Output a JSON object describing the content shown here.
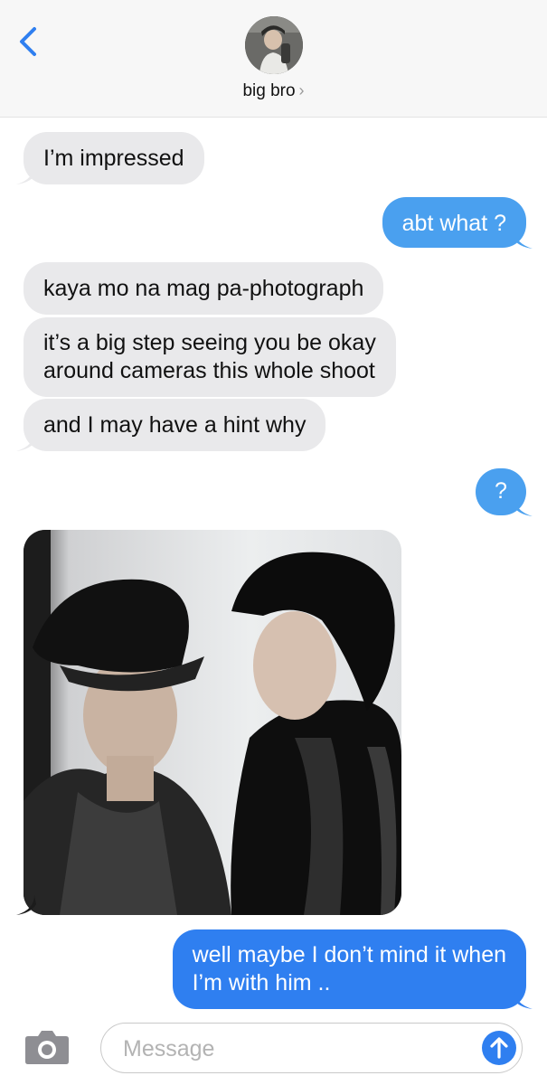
{
  "header": {
    "contact_name": "big bro",
    "chevron": "›",
    "back_icon": "chevron-left-icon"
  },
  "messages": [
    {
      "direction": "incoming",
      "text": "I’m impressed"
    },
    {
      "direction": "outgoing",
      "text": "abt what ?"
    },
    {
      "direction": "incoming",
      "text": "kaya mo na mag pa-photograph"
    },
    {
      "direction": "incoming",
      "lines": [
        "it’s a big step seeing you be okay",
        "around cameras this whole shoot"
      ]
    },
    {
      "direction": "incoming",
      "text": "and I may have a hint why"
    },
    {
      "direction": "outgoing",
      "text": "?"
    },
    {
      "direction": "incoming",
      "type": "photo",
      "description_icon": "photo-attachment"
    },
    {
      "direction": "outgoing",
      "lines": [
        "well maybe I don’t mind it when",
        "I’m with him .."
      ]
    }
  ],
  "composer": {
    "placeholder": "Message",
    "camera_icon": "camera-icon",
    "send_icon": "arrow-up-icon"
  },
  "colors": {
    "incoming_bubble": "#e9e9eb",
    "outgoing_bubble": "#4aa0ef",
    "outgoing_bubble_last": "#2f7ff0",
    "accent": "#2f7ff0"
  }
}
